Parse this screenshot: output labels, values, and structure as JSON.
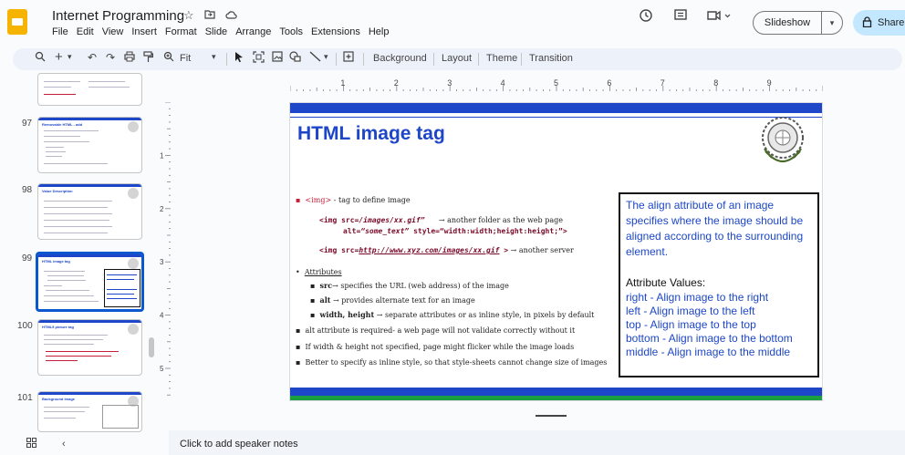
{
  "header": {
    "title": "Internet Programming",
    "icons": [
      "star-icon",
      "move-to-folder-icon",
      "cloud-status-icon"
    ],
    "menu": [
      "File",
      "Edit",
      "View",
      "Insert",
      "Format",
      "Slide",
      "Arrange",
      "Tools",
      "Extensions",
      "Help"
    ],
    "slideshow_label": "Slideshow",
    "share_label": "Share"
  },
  "toolbar": {
    "zoom_label": "Fit",
    "background_label": "Background",
    "layout_label": "Layout",
    "theme_label": "Theme",
    "transition_label": "Transition"
  },
  "ruler": {
    "numbers": [
      "1",
      "2",
      "3",
      "4",
      "5",
      "6",
      "7",
      "8",
      "9"
    ],
    "v_numbers": [
      "1",
      "2",
      "3",
      "4",
      "5"
    ]
  },
  "filmstrip": {
    "slides": [
      {
        "number": "97",
        "title": "Removable HTML - add"
      },
      {
        "number": "98",
        "title": "Value    Description"
      },
      {
        "number": "99",
        "title": "HTML image tag"
      },
      {
        "number": "100",
        "title": "HTML5 picture tag"
      },
      {
        "number": "101",
        "title": "Background image"
      }
    ]
  },
  "slide": {
    "title": "HTML image tag",
    "bullet1_tag": "<img>",
    "bullet1_text": " - tag to define image",
    "code1_a": "<img src=",
    "code1_b": "/images/xx.gif”",
    "code1_arrow": "→ another folder as the  web page",
    "code2_a": "alt=",
    "code2_b": "“some_text”",
    "code2_c": "  style=“width:width;height:height;”>",
    "code3_a": "<img src=",
    "code3_b": "http://www.xyz.com/images/xx.gif",
    "code3_c": " >",
    "code3_arrow": "  → another server",
    "attributes_label": "Attributes",
    "attr_src_key": "src",
    "attr_src_text": "→ specifies the URL (web address) of the image",
    "attr_alt_key": "alt",
    "attr_alt_text": "→ provides alternate text for an image",
    "attr_wh_key": "width, height",
    "attr_wh_text": "→ separate attributes or as inline style, in pixels by default",
    "line_alt": "alt attribute is required- a web page will not validate correctly without it",
    "line_flicker": "If width & height not specified, page might flicker while the image loads",
    "line_inline": "Better to specify as inline style, so that style-sheets cannot change size of images",
    "callout_intro": "The align attribute of an image specifies where the image should be aligned according to the surrounding element.",
    "callout_values_title": "Attribute Values:",
    "callout_values": [
      "right - Align image to the right",
      "left - Align image to the left",
      "top - Align image to the top",
      "bottom - Align image to the bottom",
      "middle - Align image to the middle"
    ]
  },
  "notes": {
    "placeholder": "Click to add speaker notes"
  },
  "colors": {
    "accent": "#0b57d0",
    "slide_blue": "#1d47c8",
    "slide_green": "#1a9e3f",
    "share_bg": "#c2e7ff"
  }
}
